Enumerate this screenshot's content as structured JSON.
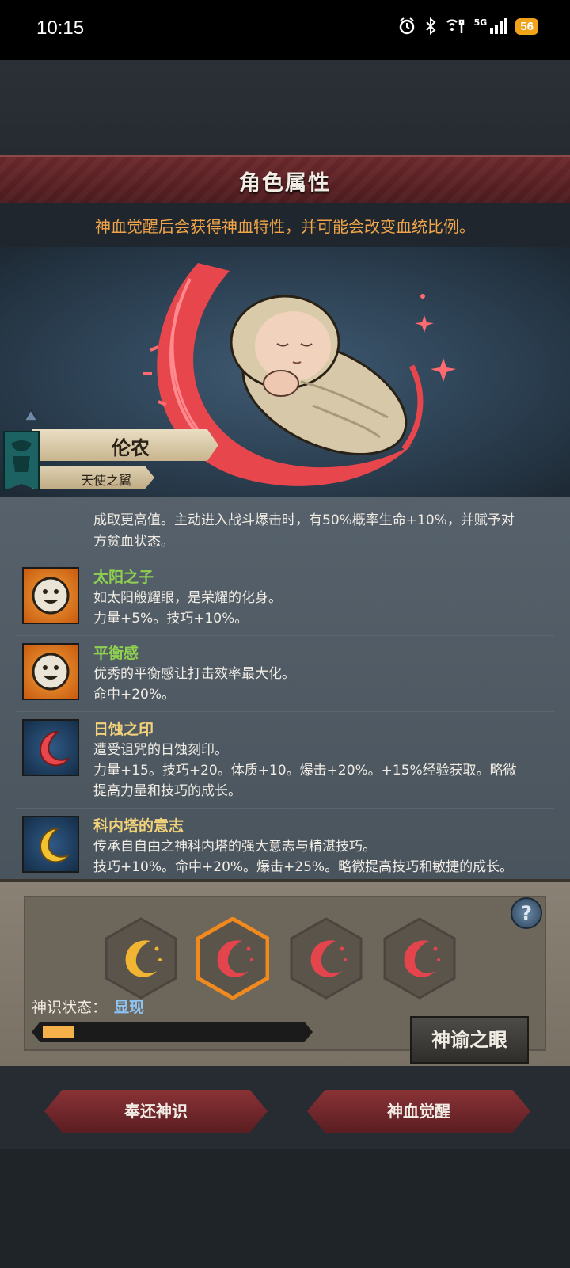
{
  "status_bar": {
    "time": "10:15",
    "network": "5G",
    "battery": "56"
  },
  "header": {
    "title": "角色属性"
  },
  "notice": "神血觉醒后会获得神血特性，并可能会改变血统比例。",
  "character": {
    "name": "伦农",
    "subtitle": "天使之翼"
  },
  "traits_top_cut": {
    "line1": "成取更高值。主动进入战斗爆击时，有50%概率生命+10%，并赋予对",
    "line2": "方贫血状态。"
  },
  "traits": [
    {
      "name": "太阳之子",
      "name_color": "#8fd14f",
      "desc1": "如太阳般耀眼，是荣耀的化身。",
      "desc2": "力量+5%。技巧+10%。",
      "desc3": "",
      "icon": "smiley-sun-icon"
    },
    {
      "name": "平衡感",
      "name_color": "#8fd14f",
      "desc1": "优秀的平衡感让打击效率最大化。",
      "desc2": "命中+20%。",
      "desc3": "",
      "icon": "smiley-sun-icon"
    },
    {
      "name": "日蚀之印",
      "name_color": "#f2d27a",
      "desc1": "遭受诅咒的日蚀刻印。",
      "desc2": "力量+15。技巧+20。体质+10。爆击+20%。+15%经验获取。略微",
      "desc3": "提高力量和技巧的成长。",
      "icon": "red-crescent-icon"
    },
    {
      "name": "科内塔的意志",
      "name_color": "#f2d27a",
      "desc1": "传承自自由之神科内塔的强大意志与精湛技巧。",
      "desc2": "技巧+10%。命中+20%。爆击+25%。略微提高技巧和敏捷的成长。",
      "desc3": "",
      "icon": "gold-crescent-icon"
    }
  ],
  "gems": [
    {
      "color": "#f1b433",
      "selected": false
    },
    {
      "color": "#e4454c",
      "selected": true
    },
    {
      "color": "#e4454c",
      "selected": false
    },
    {
      "color": "#e4454c",
      "selected": false
    }
  ],
  "divine_state": {
    "label": "神识状态：",
    "value": "显现",
    "progress": 0.12
  },
  "help_label": "?",
  "oracle_button": "神谕之眼",
  "actions": {
    "return_label": "奉还神识",
    "awaken_label": "神血觉醒"
  }
}
